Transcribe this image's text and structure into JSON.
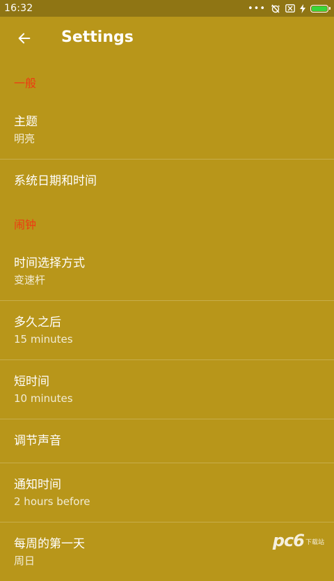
{
  "status_bar": {
    "time": "16:32",
    "icons": [
      "more-dots-icon",
      "alarm-off-icon",
      "sim-off-icon",
      "charging-icon",
      "battery-icon"
    ],
    "battery_level": 1.0,
    "battery_color": "#37d63a"
  },
  "app_bar": {
    "title": "Settings",
    "back_icon": "arrow-back-icon"
  },
  "sections": {
    "general": {
      "header": "一般",
      "items": [
        {
          "title": "主题",
          "summary": "明亮"
        },
        {
          "title": "系统日期和时间"
        }
      ]
    },
    "alarm": {
      "header": "闹钟",
      "items": [
        {
          "title": "时间选择方式",
          "summary": "变速杆"
        },
        {
          "title": "多久之后",
          "summary": "15 minutes"
        },
        {
          "title": "短时间",
          "summary": "10 minutes"
        },
        {
          "title": "调节声音"
        },
        {
          "title": "通知时间",
          "summary": "2 hours before"
        },
        {
          "title": "每周的第一天",
          "summary": "周日"
        }
      ]
    }
  },
  "watermark": {
    "text": "pc6",
    "sub": "下载站"
  },
  "colors": {
    "background": "#b8961a",
    "status_bar": "#8f7514",
    "section_header": "#ee3a12",
    "text": "#ffffff"
  }
}
